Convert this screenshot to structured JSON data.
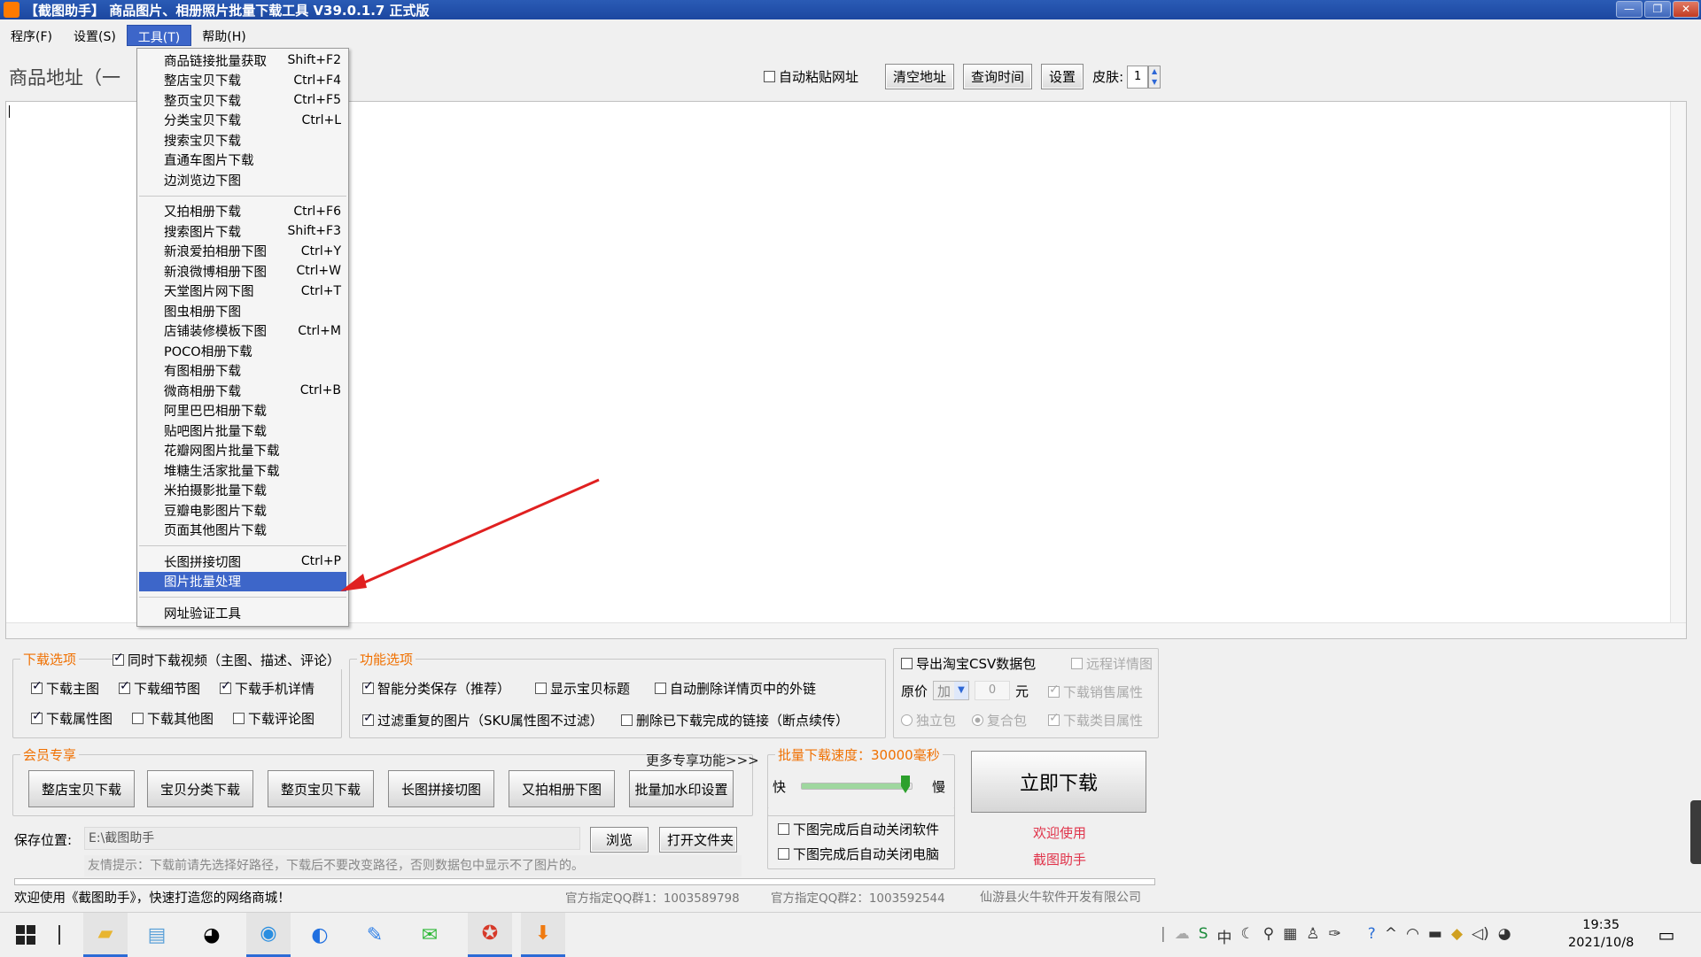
{
  "window": {
    "title": "【截图助手】 商品图片、相册照片批量下载工具 V39.0.1.7 正式版",
    "controls": [
      "—",
      "❐",
      "✕"
    ]
  },
  "menubar": [
    "程序(F)",
    "设置(S)",
    "工具(T)",
    "帮助(H)"
  ],
  "address": {
    "label": "商品地址（一",
    "auto_paste": "自动粘贴网址",
    "clear": "清空地址",
    "query_time": "查询时间",
    "settings": "设置",
    "skin_label": "皮肤:",
    "skin_value": "1"
  },
  "tools_menu": {
    "group1": [
      {
        "label": "商品链接批量获取",
        "shortcut": "Shift+F2"
      },
      {
        "label": "整店宝贝下载",
        "shortcut": "Ctrl+F4"
      },
      {
        "label": "整页宝贝下载",
        "shortcut": "Ctrl+F5"
      },
      {
        "label": "分类宝贝下载",
        "shortcut": "Ctrl+L"
      },
      {
        "label": "搜索宝贝下载",
        "shortcut": ""
      },
      {
        "label": "直通车图片下载",
        "shortcut": ""
      },
      {
        "label": "边浏览边下图",
        "shortcut": ""
      }
    ],
    "group2": [
      {
        "label": "又拍相册下载",
        "shortcut": "Ctrl+F6"
      },
      {
        "label": "搜索图片下载",
        "shortcut": "Shift+F3"
      },
      {
        "label": "新浪爱拍相册下图",
        "shortcut": "Ctrl+Y"
      },
      {
        "label": "新浪微博相册下图",
        "shortcut": "Ctrl+W"
      },
      {
        "label": "天堂图片网下图",
        "shortcut": "Ctrl+T"
      },
      {
        "label": "图虫相册下图",
        "shortcut": ""
      },
      {
        "label": "店铺装修模板下图",
        "shortcut": "Ctrl+M"
      },
      {
        "label": "POCO相册下载",
        "shortcut": ""
      },
      {
        "label": "有图相册下载",
        "shortcut": ""
      },
      {
        "label": "微商相册下载",
        "shortcut": "Ctrl+B"
      },
      {
        "label": "阿里巴巴相册下载",
        "shortcut": ""
      },
      {
        "label": "贴吧图片批量下载",
        "shortcut": ""
      },
      {
        "label": "花瓣网图片批量下载",
        "shortcut": ""
      },
      {
        "label": "堆糖生活家批量下载",
        "shortcut": ""
      },
      {
        "label": "米拍摄影批量下载",
        "shortcut": ""
      },
      {
        "label": "豆瓣电影图片下载",
        "shortcut": ""
      },
      {
        "label": "页面其他图片下载",
        "shortcut": ""
      }
    ],
    "group3": [
      {
        "label": "长图拼接切图",
        "shortcut": "Ctrl+P"
      },
      {
        "label": "图片批量处理",
        "shortcut": "",
        "highlighted": true
      }
    ],
    "group4": [
      {
        "label": "网址验证工具",
        "shortcut": ""
      }
    ]
  },
  "download_options": {
    "legend": "下载选项",
    "video": "同时下载视频（主图、描述、评论）",
    "main_image": "下载主图",
    "detail_image": "下载细节图",
    "mobile_detail": "下载手机详情",
    "attr_image": "下载属性图",
    "other_image": "下载其他图",
    "review_image": "下载评论图"
  },
  "function_options": {
    "legend": "功能选项",
    "smart_save": "智能分类保存（推荐）",
    "show_title": "显示宝贝标题",
    "auto_remove_links": "自动删除详情页中的外链",
    "filter_dup": "过滤重复的图片（SKU属性图不过滤）",
    "delete_done": "删除已下载完成的链接（断点续传）"
  },
  "export": {
    "csv": "导出淘宝CSV数据包",
    "remote_detail": "远程详情图",
    "price_label": "原价",
    "price_op": "加",
    "price_value": "0",
    "price_unit": "元",
    "sales_attr": "下载销售属性",
    "single_pack": "独立包",
    "merged_pack": "复合包",
    "category_attr": "下载类目属性"
  },
  "member": {
    "legend": "会员专享",
    "more": "更多专享功能>>>",
    "buttons": [
      "整店宝贝下载",
      "宝贝分类下载",
      "整页宝贝下载",
      "长图拼接切图",
      "又拍相册下图",
      "批量加水印设置"
    ]
  },
  "speed": {
    "legend": "批量下载速度：30000毫秒",
    "fast": "快",
    "slow": "慢",
    "level": 0.92,
    "close_app": "下图完成后自动关闭软件",
    "shutdown": "下图完成后自动关闭电脑"
  },
  "start_button": "立即下载",
  "welcome_lines": [
    "欢迎使用",
    "截图助手"
  ],
  "save": {
    "label": "保存位置:",
    "path": "E:\\截图助手",
    "browse": "浏览",
    "open_folder": "打开文件夹",
    "tip": "友情提示：下载前请先选择好路径，下载后不要改变路径，否则数据包中显示不了图片的。"
  },
  "status": {
    "welcome": "欢迎使用《截图助手》，快速打造您的网络商城！",
    "qq1": "官方指定QQ群1：1003589798",
    "qq2": "官方指定QQ群2：1003592544",
    "company": "仙游县火牛软件开发有限公司"
  },
  "taskbar": {
    "time": "19:35",
    "date": "2021/10/8",
    "tray_ime": "中"
  },
  "colors": {
    "accent": "#3d66c9",
    "legend": "#f07000",
    "arrow": "#e02020",
    "welcome": "#e0334a"
  }
}
